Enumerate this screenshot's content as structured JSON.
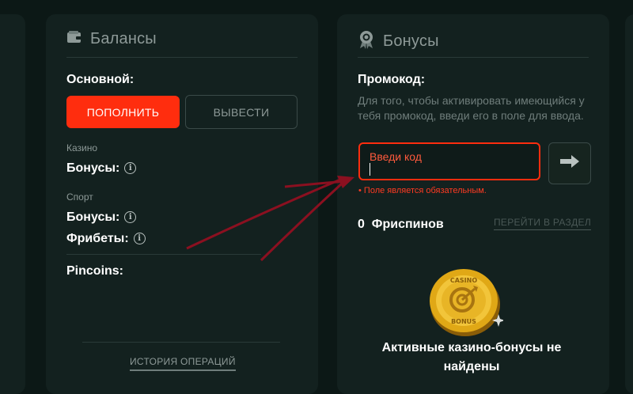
{
  "balances": {
    "title": "Балансы",
    "main_label": "Основной:",
    "deposit_button": "ПОПОЛНИТЬ",
    "withdraw_button": "ВЫВЕСТИ",
    "casino_section": "Казино",
    "casino_bonuses_label": "Бонусы:",
    "sport_section": "Спорт",
    "sport_bonuses_label": "Бонусы:",
    "freebets_label": "Фрибеты:",
    "pincoins_label": "Pincoins:",
    "history_link": "ИСТОРИЯ ОПЕРАЦИЙ"
  },
  "bonuses": {
    "title": "Бонусы",
    "promo_label": "Промокод:",
    "promo_description": "Для того, чтобы активировать имеющийся у тебя промокод, введи его в поле для ввода.",
    "promo_placeholder": "Введи код",
    "promo_error": "• Поле является обязательным.",
    "freespins_count": "0",
    "freespins_label": "Фриспинов",
    "goto_section_link": "ПЕРЕЙТИ В РАЗДЕЛ",
    "coin_text_top": "CASINO",
    "coin_text_bottom": "BONUS",
    "empty_message": "Активные казино-бонусы не найдены"
  },
  "icons": {
    "wallet": "wallet-icon",
    "badge": "medal-icon",
    "info": "info-icon",
    "arrow": "arrow-right-icon",
    "coin": "casino-bonus-coin"
  },
  "colors": {
    "background": "#0c1816",
    "panel": "#13211f",
    "accent_red": "#ff2d0e",
    "muted_text": "#8e9a98",
    "annotation_arrow": "#8b1020"
  }
}
